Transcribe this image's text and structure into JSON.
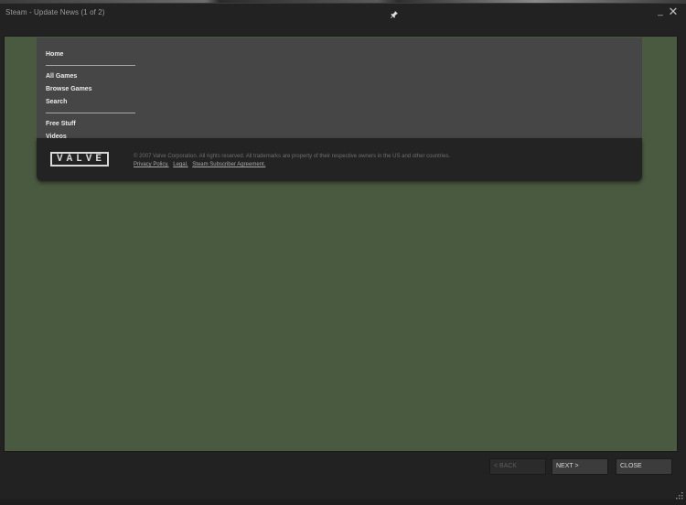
{
  "window": {
    "title": "Steam - Update News (1 of 2)",
    "minimize_glyph": "_",
    "close_glyph": "✕",
    "icons": [
      "pin-icon",
      "resize-grip-icon"
    ]
  },
  "nav": {
    "items": [
      {
        "label": "Home"
      },
      {
        "label": "All Games"
      },
      {
        "label": "Browse Games"
      },
      {
        "label": "Search"
      },
      {
        "label": "Free Stuff"
      },
      {
        "label": "Videos"
      }
    ]
  },
  "footer": {
    "logo_text": "VALVE",
    "copyright": "© 2007 Valve Corporation. All rights reserved. All trademarks are property of their respective owners in the US and other countries.",
    "links": [
      {
        "label": "Privacy Policy."
      },
      {
        "label": "Legal."
      },
      {
        "label": "Steam Subscriber Agreement."
      }
    ]
  },
  "buttons": {
    "back": "< BACK",
    "next": "NEXT >",
    "close": "CLOSE"
  },
  "colors": {
    "window_bg": "#222222",
    "content_bg": "#4a5a40",
    "panel_bg": "#464646",
    "footer_bg": "#232323"
  }
}
